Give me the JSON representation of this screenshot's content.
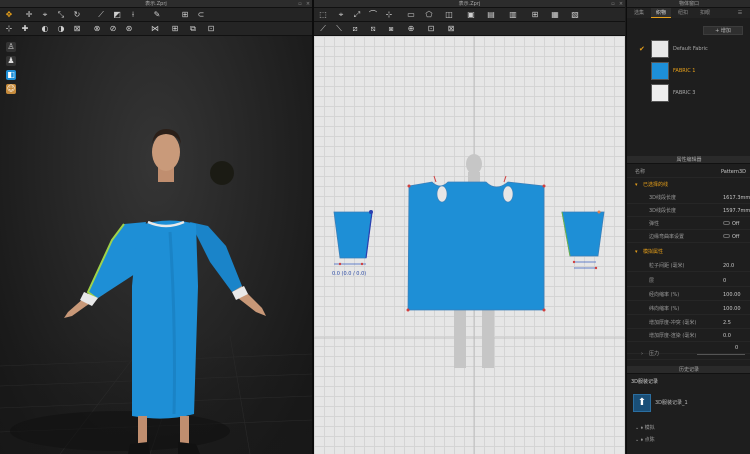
{
  "left_window": {
    "title": "表示.Zprj"
  },
  "center_window": {
    "title": "表示.Zprj"
  },
  "right_panel": {
    "library_title": "物体窗口",
    "tabs": [
      "选集",
      "织物",
      "纽扣",
      "扣眼"
    ],
    "active_tab": 1,
    "add_button": "+ 增加",
    "fabrics": [
      {
        "name": "Default Fabric",
        "color": "#e9e9e9",
        "selected": false,
        "checked": true
      },
      {
        "name": "FABRIC 1",
        "color": "#1d8fd8",
        "selected": true,
        "checked": false
      },
      {
        "name": "FABRIC 3",
        "color": "#eeeeee",
        "selected": false,
        "checked": false
      }
    ],
    "property_editor": {
      "title": "属性编辑器",
      "name_label": "名称",
      "name_value": "Pattern3D",
      "section1": "已选择的线",
      "rows1": [
        {
          "k": "3D线段长度",
          "v": "1617.3mm"
        },
        {
          "k": "3D线段长度",
          "v": "1597.7mm"
        },
        {
          "k": "弹性",
          "v": "Off"
        },
        {
          "k": "边缘弯曲率设置",
          "v": "Off"
        }
      ],
      "section2": "模拟属性",
      "rows2": [
        {
          "k": "粒子间距 (毫米)",
          "v": "20.0"
        },
        {
          "k": "层",
          "v": "0"
        },
        {
          "k": "经向缩率 (%)",
          "v": "100.00"
        },
        {
          "k": "纬向缩率 (%)",
          "v": "100.00"
        },
        {
          "k": "增加厚度-冲突 (毫米)",
          "v": "2.5"
        },
        {
          "k": "增加厚度-渲染 (毫米)",
          "v": "0.0"
        },
        {
          "k": "",
          "v": "0"
        }
      ],
      "pressure_label": "压力"
    },
    "history": {
      "title": "历史记录",
      "heading": "3D服装记录",
      "item": "3D服装记录_1",
      "sub1": "模拟",
      "sub2": "点陈"
    }
  },
  "pattern_labels": {
    "sleeve_left_measure": "0.0 (0.0 / 0.0)"
  },
  "colors": {
    "accent": "#e8a019",
    "fabric_blue": "#1d8fd8",
    "pattern_blue": "#1e8fd6"
  }
}
